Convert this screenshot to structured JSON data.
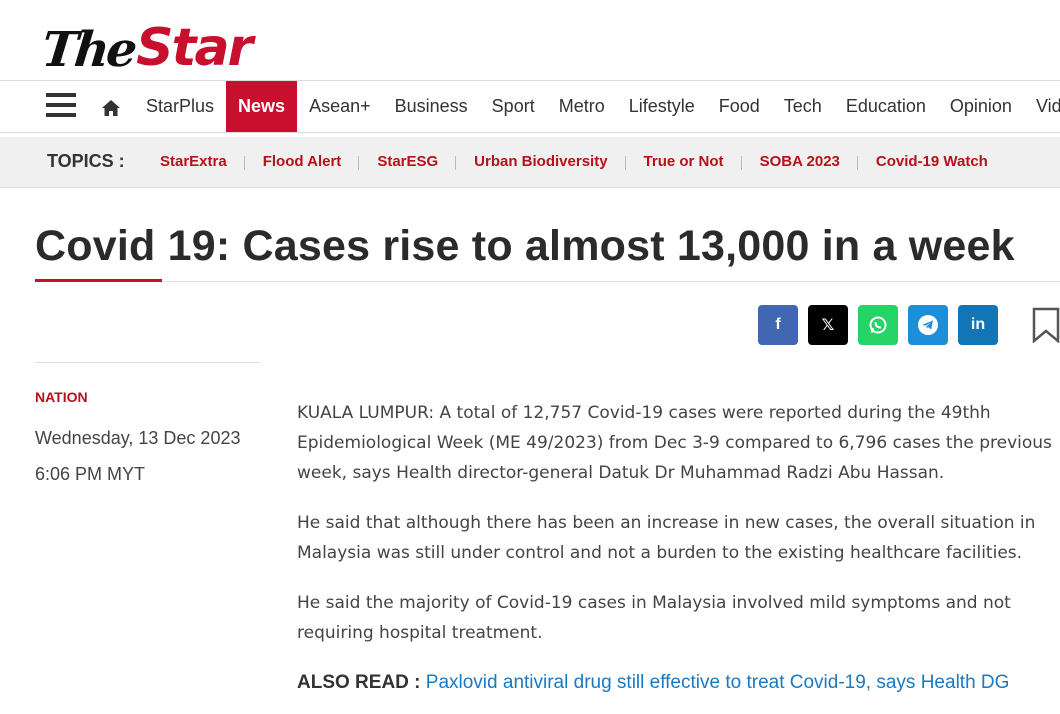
{
  "site": {
    "logo_text_the": "The",
    "logo_text_star": "Star"
  },
  "nav": {
    "items": [
      {
        "label": "StarPlus"
      },
      {
        "label": "News",
        "active": true
      },
      {
        "label": "Asean+"
      },
      {
        "label": "Business"
      },
      {
        "label": "Sport"
      },
      {
        "label": "Metro"
      },
      {
        "label": "Lifestyle"
      },
      {
        "label": "Food"
      },
      {
        "label": "Tech"
      },
      {
        "label": "Education"
      },
      {
        "label": "Opinion"
      },
      {
        "label": "Vid"
      }
    ]
  },
  "topics": {
    "label": "TOPICS :",
    "items": [
      {
        "label": "StarExtra"
      },
      {
        "label": "Flood Alert"
      },
      {
        "label": "StarESG"
      },
      {
        "label": "Urban Biodiversity"
      },
      {
        "label": "True or Not"
      },
      {
        "label": "SOBA 2023"
      },
      {
        "label": "Covid-19 Watch"
      }
    ]
  },
  "article": {
    "headline": "Covid 19: Cases rise to almost 13,000 in a week",
    "category": "NATION",
    "date": "Wednesday, 13 Dec 2023",
    "time": "6:06 PM MYT",
    "paragraphs": [
      "KUALA LUMPUR: A total of 12,757 Covid-19 cases were reported during the 49thh Epidemiological Week (ME 49/2023) from Dec 3-9 compared to 6,796 cases the previous week, says Health director-general Datuk Dr Muhammad Radzi Abu Hassan.",
      "He said that although there has been an increase in new cases, the overall situation in Malaysia was still under control and not a burden to the existing healthcare facilities.",
      "He said the majority of Covid-19 cases in Malaysia involved mild symptoms and not requiring hospital treatment."
    ],
    "also_read": {
      "label": "ALSO READ :",
      "link_text": "Paxlovid antiviral drug still effective to treat Covid-19, says Health DG"
    }
  },
  "share": {
    "facebook_glyph": "f",
    "x_glyph": "𝕏",
    "linkedin_glyph": "in"
  },
  "colors": {
    "brand_red": "#c8102e",
    "topic_red": "#b5121b",
    "link_blue": "#1a79c2",
    "facebook": "#4267b2",
    "x": "#000000",
    "whatsapp": "#25d366",
    "telegram": "#1d8fd8",
    "linkedin": "#1175b6"
  }
}
